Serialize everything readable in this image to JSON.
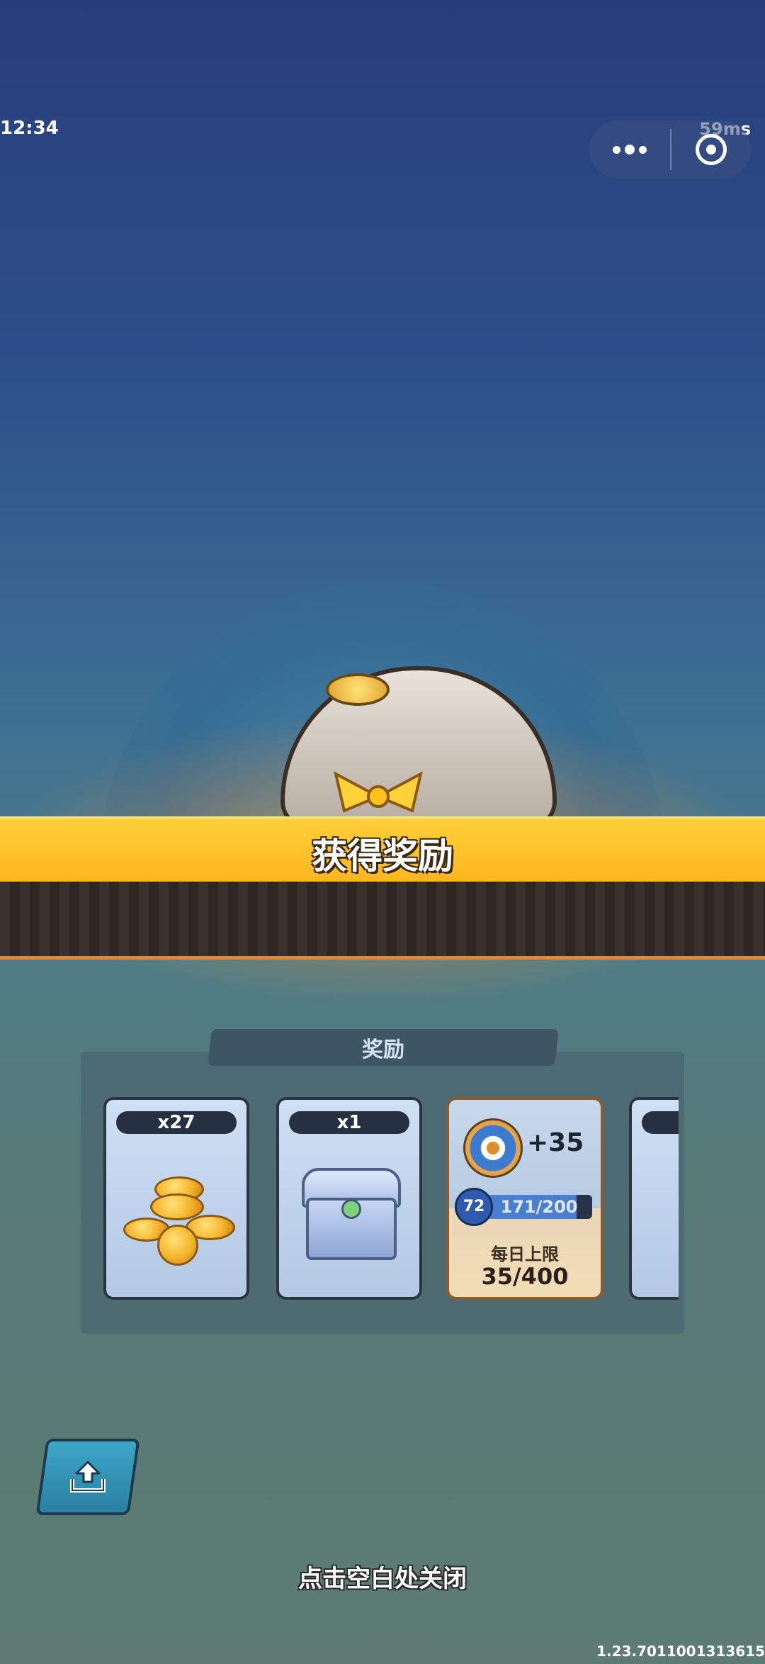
{
  "status": {
    "time": "12:34",
    "ping": "59ms"
  },
  "capsule": {
    "more_icon": "more-dots-icon",
    "close_icon": "target-icon"
  },
  "banner": {
    "title": "获得奖励"
  },
  "rewards": {
    "tab_label": "奖励",
    "items": [
      {
        "qty": "x27",
        "icon": "gold-coins-icon"
      },
      {
        "qty": "x1",
        "icon": "treasure-chest-icon"
      }
    ],
    "xp": {
      "gain": "+35",
      "level": "72",
      "progress": "171/200",
      "progress_fraction": 0.855,
      "limit_label": "每日上限",
      "limit_value": "35/400"
    }
  },
  "footer": {
    "close_hint": "点击空白处关闭",
    "version": "1.23.7011001313615"
  }
}
